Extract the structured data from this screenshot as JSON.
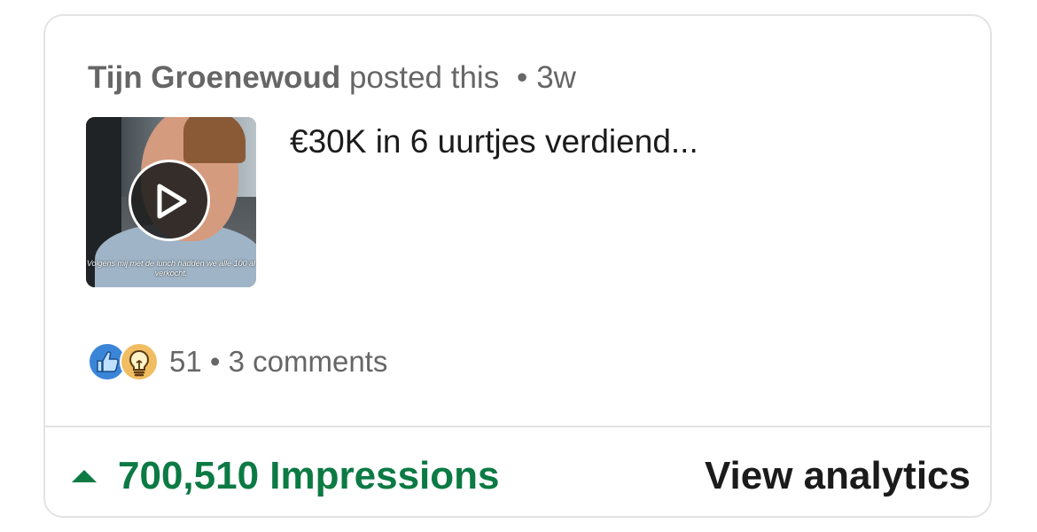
{
  "post": {
    "author": "Tijn Groenewoud",
    "action": "posted this",
    "separator": "•",
    "age": "3w",
    "title": "€30K in 6 uurtjes verdiend...",
    "video_caption": "Volgens mij met de lunch hadden we alle 100 al verkocht."
  },
  "engagement": {
    "reaction_icons": [
      "like-icon",
      "insightful-icon"
    ],
    "reaction_count": "51",
    "separator": "•",
    "comments": "3 comments"
  },
  "footer": {
    "impressions_label": "700,510 Impressions",
    "view_analytics_label": "View analytics",
    "accent_color": "#0b7a43"
  }
}
